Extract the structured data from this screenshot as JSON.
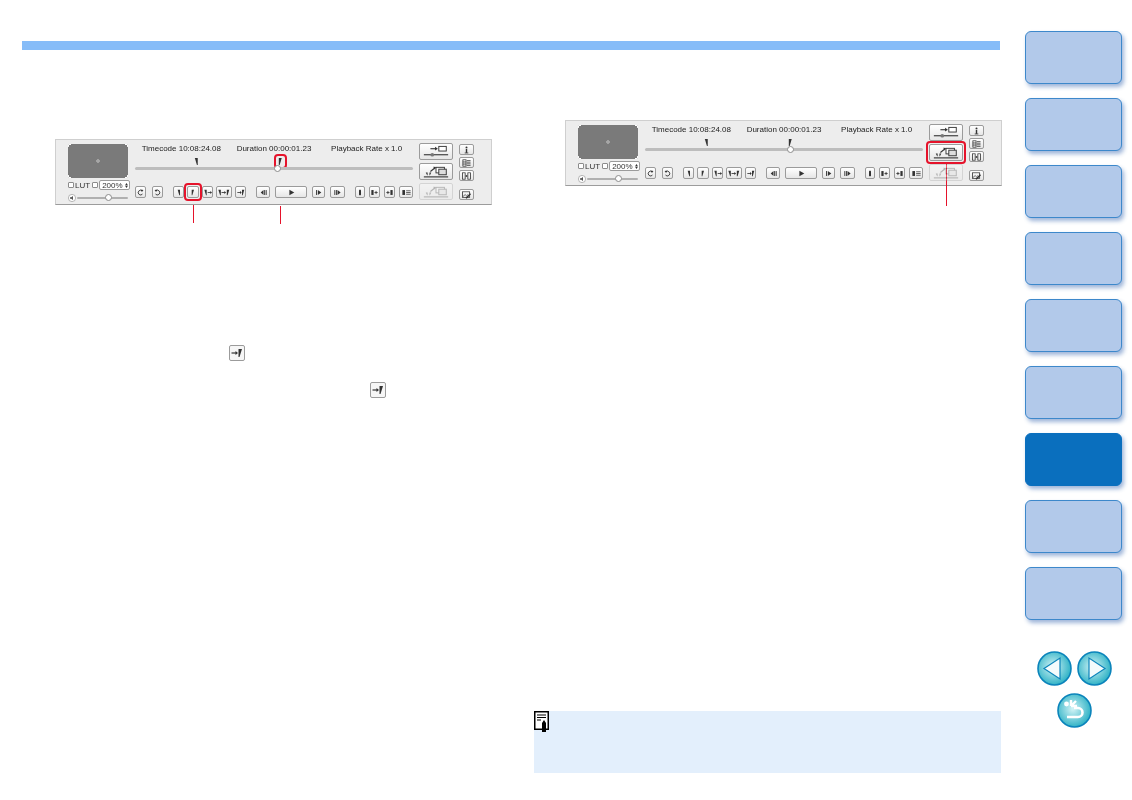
{
  "figures": [
    {
      "readouts": [
        "Timecode 10:08:24.08",
        "Duration 00:00:01.23",
        "Playback Rate x 1.0"
      ],
      "lut": {
        "label": "LUT",
        "checked": false
      },
      "zoom": {
        "checked": false,
        "value": "200%"
      },
      "volume": {
        "level": 0.6
      },
      "timeline": {
        "level": 0.51,
        "markers": [
          {
            "kind": "in",
            "level": 0.22,
            "highlighted": false
          },
          {
            "kind": "out",
            "level": 0.52,
            "highlighted": true
          }
        ]
      },
      "button_groups": [
        {
          "buttons": [
            {
              "kind": "rotate-left",
              "highlighted": false
            },
            {
              "kind": "rotate-right",
              "highlighted": false
            }
          ]
        },
        {
          "buttons": [
            {
              "kind": "set-in",
              "highlighted": false
            },
            {
              "kind": "set-out",
              "highlighted": true
            },
            {
              "kind": "jump-in",
              "highlighted": false
            },
            {
              "kind": "jump-in-out",
              "highlighted": false
            },
            {
              "kind": "jump-out",
              "highlighted": false
            }
          ]
        },
        {
          "buttons": [
            {
              "kind": "step-back",
              "highlighted": false
            },
            {
              "kind": "play",
              "highlighted": false
            },
            {
              "kind": "step-forward",
              "highlighted": false
            },
            {
              "kind": "skip-end",
              "highlighted": false
            }
          ]
        },
        {
          "buttons": [
            {
              "kind": "clip",
              "highlighted": false
            },
            {
              "kind": "clip-add",
              "highlighted": false
            },
            {
              "kind": "add-clip",
              "highlighted": false
            },
            {
              "kind": "clip-list",
              "highlighted": false
            }
          ]
        }
      ],
      "actions": [
        {
          "kind": "apply",
          "disabled": false,
          "highlighted": false
        },
        {
          "kind": "export",
          "disabled": false,
          "highlighted": false
        },
        {
          "kind": "export",
          "disabled": true,
          "highlighted": false
        }
      ],
      "panels": [
        {
          "kind": "info"
        },
        {
          "kind": "list"
        },
        {
          "kind": "compare"
        },
        {
          "kind": "edit"
        }
      ]
    },
    {
      "readouts": [
        "Timecode 10:08:24.08",
        "Duration 00:00:01.23",
        "Playback Rate x 1.0"
      ],
      "lut": {
        "label": "LUT",
        "checked": false
      },
      "zoom": {
        "checked": false,
        "value": "200%"
      },
      "volume": {
        "level": 0.6
      },
      "timeline": {
        "level": 0.52,
        "markers": [
          {
            "kind": "in",
            "level": 0.22,
            "highlighted": false
          },
          {
            "kind": "out",
            "level": 0.52,
            "highlighted": false
          }
        ]
      },
      "button_groups": [
        {
          "buttons": [
            {
              "kind": "rotate-left",
              "highlighted": false
            },
            {
              "kind": "rotate-right",
              "highlighted": false
            }
          ]
        },
        {
          "buttons": [
            {
              "kind": "set-in",
              "highlighted": false
            },
            {
              "kind": "set-out",
              "highlighted": false
            },
            {
              "kind": "jump-in",
              "highlighted": false
            },
            {
              "kind": "jump-in-out",
              "highlighted": false
            },
            {
              "kind": "jump-out",
              "highlighted": false
            }
          ]
        },
        {
          "buttons": [
            {
              "kind": "step-back",
              "highlighted": false
            },
            {
              "kind": "play",
              "highlighted": false
            },
            {
              "kind": "step-forward",
              "highlighted": false
            },
            {
              "kind": "skip-end",
              "highlighted": false
            }
          ]
        },
        {
          "buttons": [
            {
              "kind": "clip",
              "highlighted": false
            },
            {
              "kind": "clip-add",
              "highlighted": false
            },
            {
              "kind": "add-clip",
              "highlighted": false
            },
            {
              "kind": "clip-list",
              "highlighted": false
            }
          ]
        }
      ],
      "actions": [
        {
          "kind": "apply",
          "disabled": false,
          "highlighted": false
        },
        {
          "kind": "export",
          "disabled": false,
          "highlighted": true
        },
        {
          "kind": "export",
          "disabled": true,
          "highlighted": false
        }
      ],
      "panels": [
        {
          "kind": "info"
        },
        {
          "kind": "list"
        },
        {
          "kind": "compare"
        },
        {
          "kind": "edit"
        }
      ]
    }
  ],
  "sidebar": {
    "tabs": [
      {
        "selected": false
      },
      {
        "selected": false
      },
      {
        "selected": false
      },
      {
        "selected": false
      },
      {
        "selected": false
      },
      {
        "selected": false
      },
      {
        "selected": true
      },
      {
        "selected": false
      },
      {
        "selected": false
      }
    ]
  }
}
